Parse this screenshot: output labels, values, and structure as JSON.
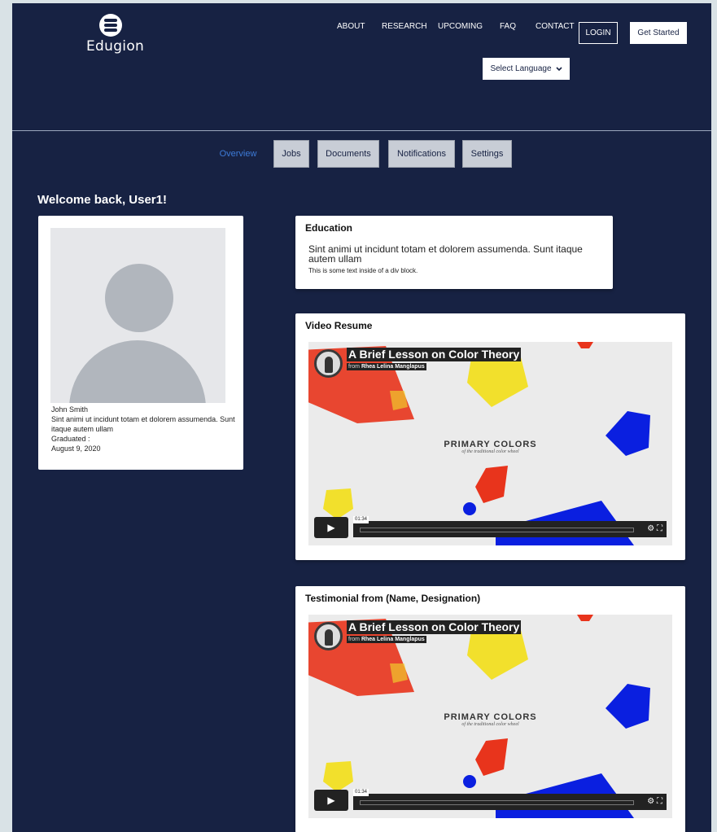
{
  "brand": {
    "name": "Edugion"
  },
  "nav": {
    "about": "ABOUT",
    "research": "RESEARCH",
    "upcoming": "UPCOMING",
    "faq": "FAQ",
    "contact": "CONTACT",
    "login": "LOGIN",
    "get_started": "Get Started"
  },
  "language": {
    "label": "Select Language"
  },
  "tabs": {
    "overview": "Overview",
    "jobs": "Jobs",
    "documents": "Documents",
    "notifications": "Notifications",
    "settings": "Settings"
  },
  "welcome": "Welcome back, User1!",
  "profile": {
    "name": "John Smith",
    "bio": "Sint animi ut incidunt totam et dolorem assumenda. Sunt itaque autem ullam",
    "graduated_label": "Graduated :",
    "graduated_date": "August 9, 2020"
  },
  "education": {
    "title": "Education",
    "body": "Sint animi ut incidunt totam et dolorem assumenda. Sunt itaque autem ullam",
    "small": "This is some text inside of a div block."
  },
  "video_resume": {
    "title": "Video Resume",
    "video_title": "A Brief Lesson on Color Theory",
    "from_prefix": "from",
    "from_author": "Rhea Lelina Manglapus",
    "center_title": "PRIMARY COLORS",
    "center_sub": "of the traditional color wheel",
    "time": "01:34"
  },
  "testimonial": {
    "title": "Testimonial from (Name, Designation)",
    "video_title": "A Brief Lesson on Color Theory",
    "from_prefix": "from",
    "from_author": "Rhea Lelina Manglapus",
    "center_title": "PRIMARY COLORS",
    "center_sub": "of the traditional color wheel",
    "time": "01:34"
  },
  "colors": {
    "background": "#172243",
    "tab_active": "#3d7bd8",
    "tab_gray": "#c8cdd6"
  }
}
